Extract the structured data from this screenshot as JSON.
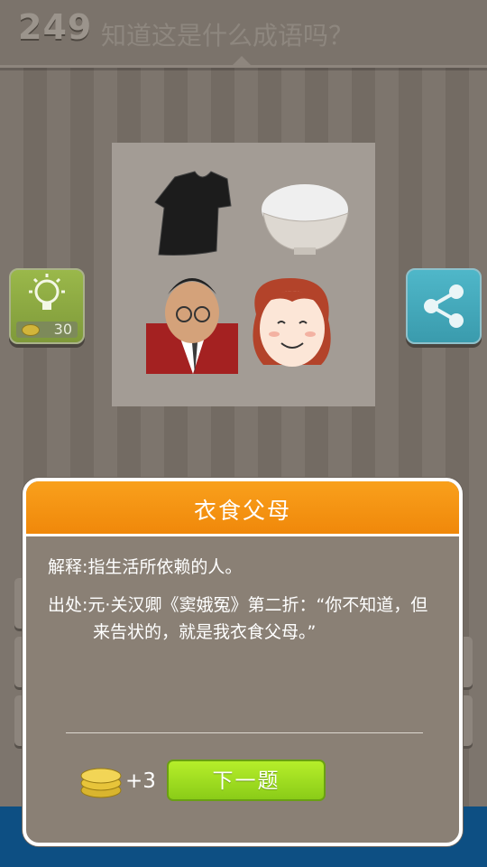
{
  "header": {
    "level": "249",
    "question": "知道这是什么成语吗？"
  },
  "hint": {
    "cost": "30"
  },
  "picture": {
    "icons": [
      "black-tshirt-icon",
      "rice-bowl-icon",
      "father-cartoon-icon",
      "mother-cartoon-icon"
    ]
  },
  "dialog": {
    "title": "衣食父母",
    "meaning": "解释:指生活所依赖的人。",
    "source": "出处:元·关汉卿《窦娥冤》第二折：“你不知道，但来告状的，就是我衣食父母。”",
    "reward": "+3",
    "next_label": "下一题"
  },
  "colors": {
    "header_orange": "#f39414",
    "next_green": "#9fdd20",
    "hint_green": "#8fae44",
    "share_teal": "#45acbe",
    "bottom_blue": "#0d4f83"
  }
}
